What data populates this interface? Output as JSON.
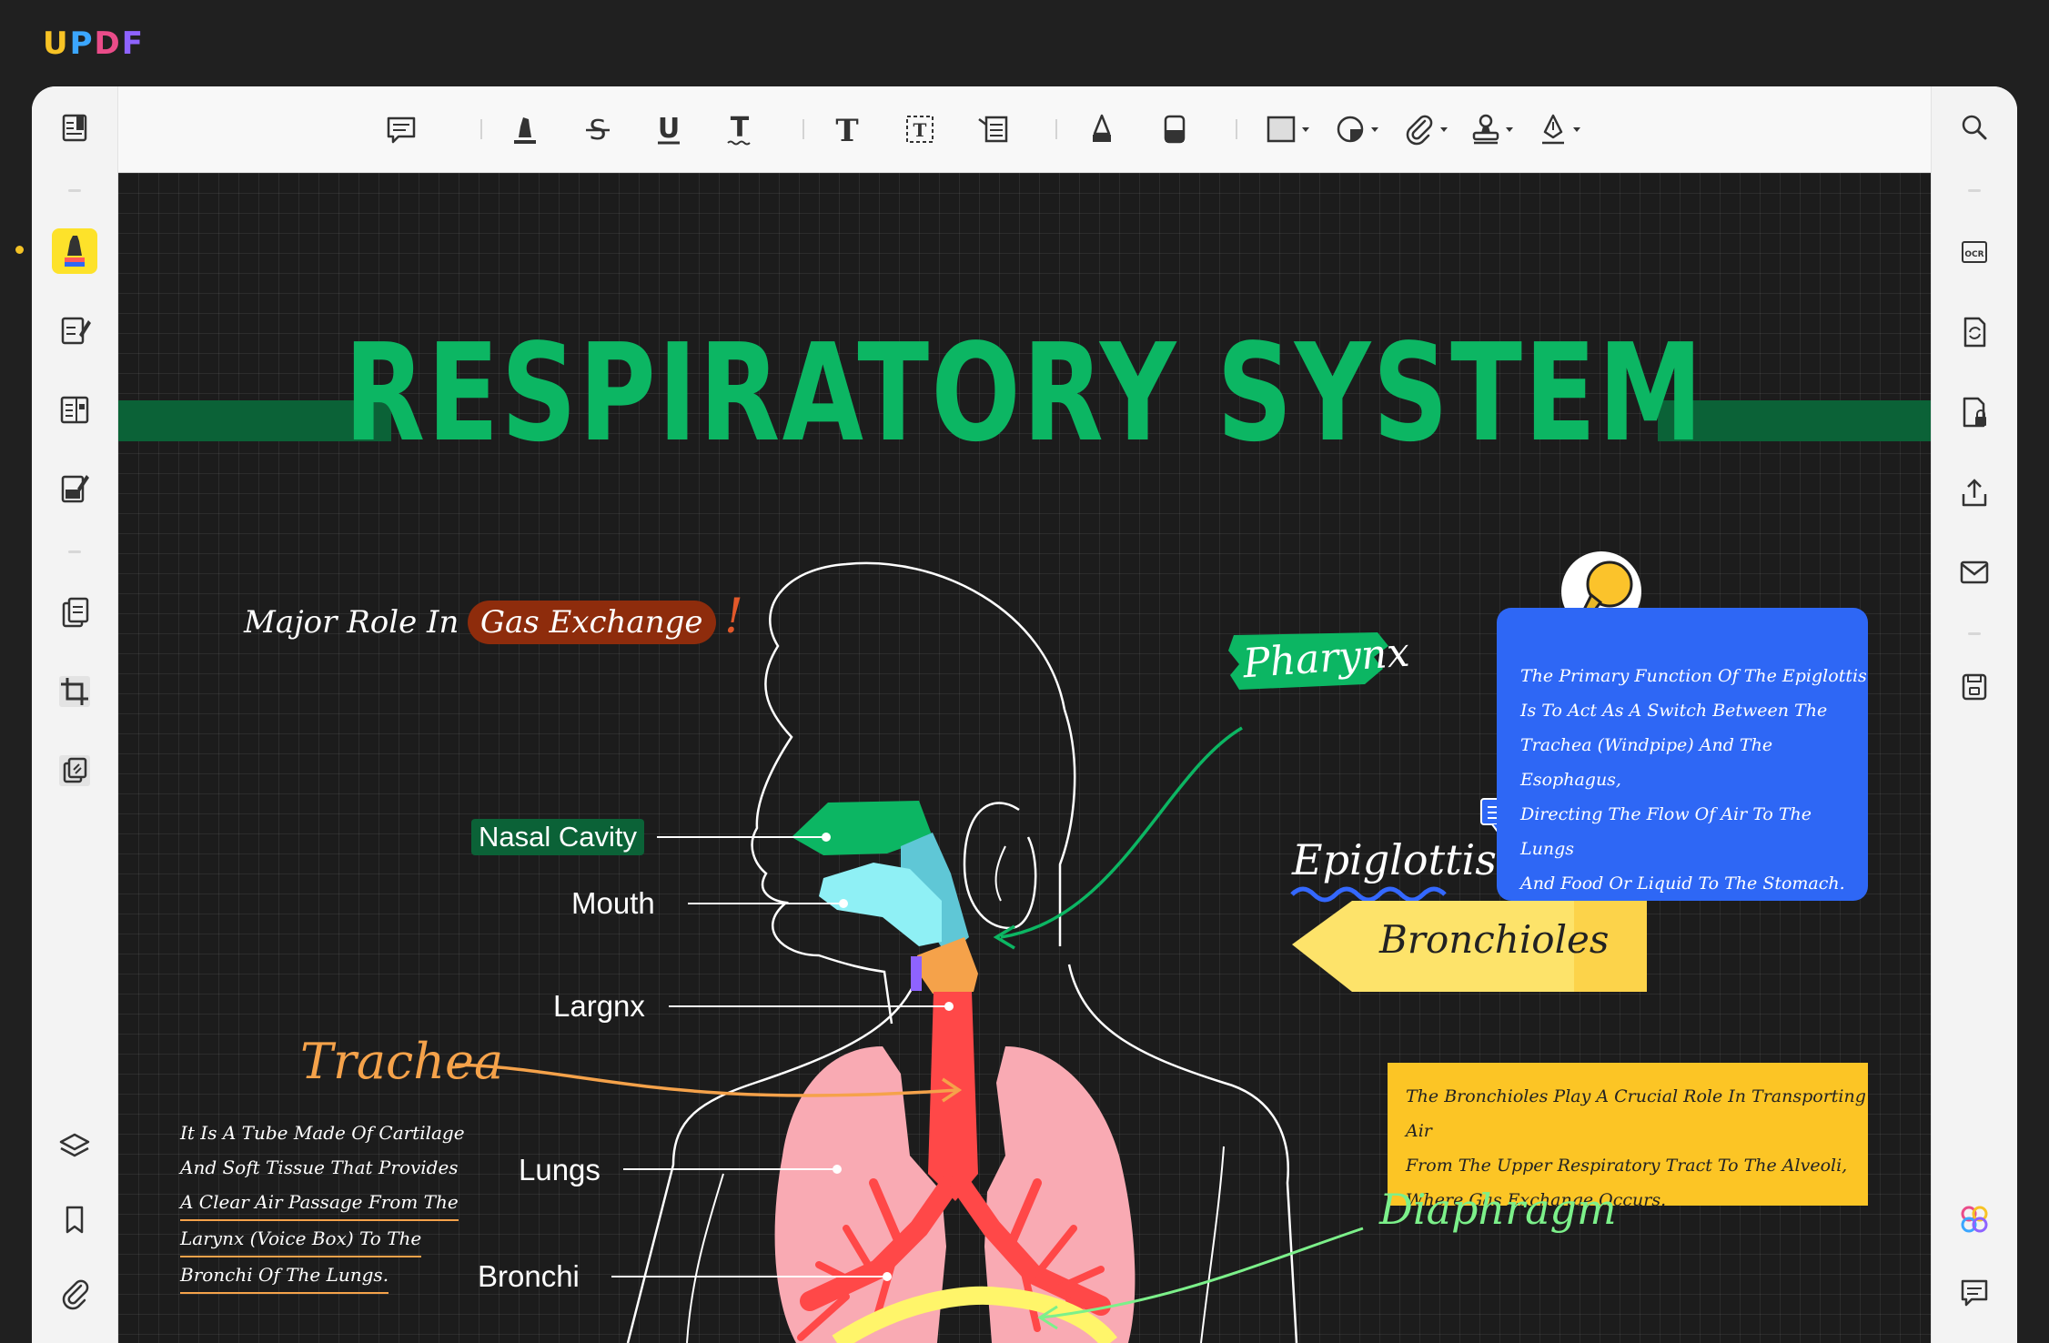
{
  "app": {
    "logo_letters": [
      "U",
      "P",
      "D",
      "F"
    ],
    "logo_colors": [
      "#f7c325",
      "#3ba6ff",
      "#ea4c89",
      "#8e63ff"
    ]
  },
  "toolbar": {
    "items": [
      "comment-icon",
      "highlight-icon",
      "strikethrough-icon",
      "underline-icon",
      "squiggly-icon",
      "text-icon",
      "textbox-icon",
      "text-callout-icon",
      "pencil-icon",
      "eraser-icon",
      "rectangle-icon",
      "shape-icon",
      "attachment-icon",
      "stamp-icon",
      "signature-icon"
    ]
  },
  "page": {
    "title": "RESPIRATORY SYSTEM",
    "subtitle_pre": "Major Role In",
    "subtitle_highlight": "Gas Exchange",
    "subtitle_mark": "!",
    "labels": {
      "nasal": "Nasal Cavity",
      "mouth": "Mouth",
      "larynx": "Largnx",
      "trachea": "Trachea",
      "lungs": "Lungs",
      "bronchi": "Bronchi",
      "pharynx": "Pharynx",
      "epiglottis": "Epiglottis",
      "bronchioles": "Bronchioles",
      "diaphragm": "Diaphragm"
    },
    "trachea_note": [
      "It Is A Tube Made Of Cartilage",
      "And Soft Tissue That Provides",
      "A Clear Air Passage From The",
      "Larynx (Voice Box) To The",
      "Bronchi Of The Lungs."
    ],
    "epiglottis_note": [
      "The Primary Function Of The Epiglottis",
      "Is To Act As A Switch Between The",
      "Trachea (Windpipe) And The Esophagus,",
      "Directing The Flow Of Air To The Lungs",
      "And Food Or Liquid To The Stomach."
    ],
    "bronchioles_note": [
      "The Bronchioles Play A Crucial Role In Transporting Air",
      "From The Upper Respiratory Tract To The Alveoli,",
      "Where Gas Exchange Occurs."
    ]
  },
  "colors": {
    "accent_green": "#0cb663",
    "note_blue": "#2e67f5",
    "note_yellow": "#fcc525",
    "trachea_orange": "#f5a24a",
    "diaphragm_green": "#7cf08a"
  }
}
